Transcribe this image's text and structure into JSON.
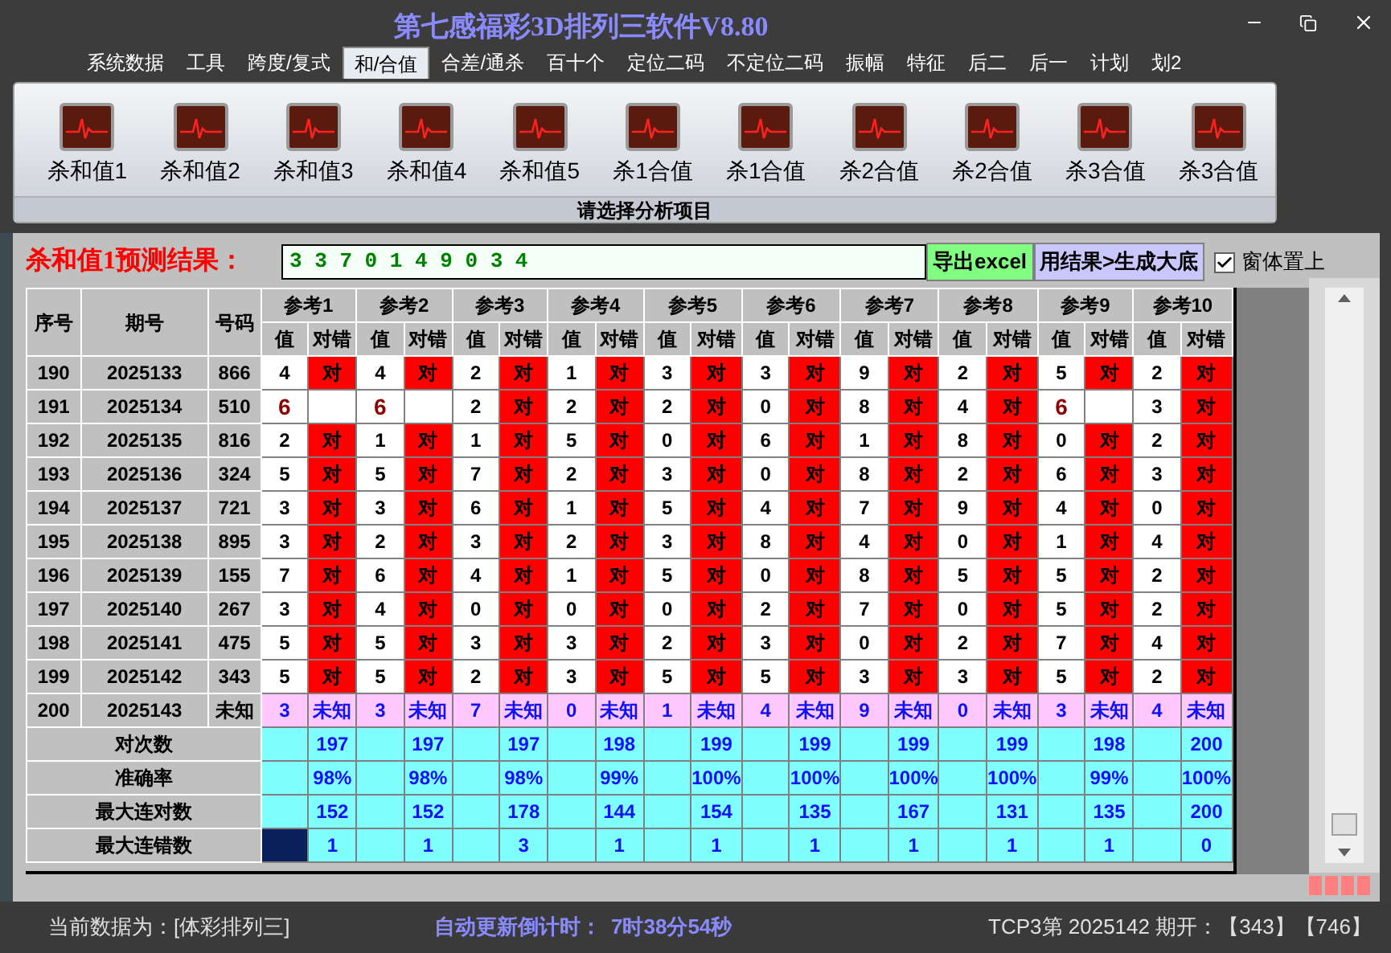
{
  "window": {
    "title": "第七感福彩3D排列三软件V8.80"
  },
  "menu_tabs": [
    {
      "label": "系统数据",
      "selected": false
    },
    {
      "label": "工具",
      "selected": false
    },
    {
      "label": "跨度/复式",
      "selected": false
    },
    {
      "label": "和/合值",
      "selected": true
    },
    {
      "label": "合差/通杀",
      "selected": false
    },
    {
      "label": "百十个",
      "selected": false
    },
    {
      "label": "定位二码",
      "selected": false
    },
    {
      "label": "不定位二码",
      "selected": false
    },
    {
      "label": "振幅",
      "selected": false
    },
    {
      "label": "特征",
      "selected": false
    },
    {
      "label": "后二",
      "selected": false
    },
    {
      "label": "后一",
      "selected": false
    },
    {
      "label": "计划",
      "selected": false
    },
    {
      "label": "划2",
      "selected": false
    }
  ],
  "ribbon": {
    "buttons": [
      "杀和值1",
      "杀和值2",
      "杀和值3",
      "杀和值4",
      "杀和值5",
      "杀1合值",
      "杀1合值",
      "杀2合值",
      "杀2合值",
      "杀3合值",
      "杀3合值"
    ],
    "caption": "请选择分析项目"
  },
  "prediction": {
    "label": "杀和值1预测结果：",
    "value": "3 3 7 0 1 4 9 0 3 4"
  },
  "action_buttons": [
    {
      "label": "导出excel",
      "color": "#80ff80"
    },
    {
      "label": "用结果>生成大底",
      "color": "#c8c8ff"
    }
  ],
  "stay_on_top": {
    "label": "窗体置上",
    "checked": true
  },
  "table": {
    "columns": [
      "序号",
      "期号",
      "号码"
    ],
    "ref_groups": [
      {
        "label": "参考1",
        "sub": [
          "值",
          "对错"
        ]
      },
      {
        "label": "参考2",
        "sub": [
          "值",
          "对错"
        ]
      },
      {
        "label": "参考3",
        "sub": [
          "值",
          "对错"
        ]
      },
      {
        "label": "参考4",
        "sub": [
          "值",
          "对错"
        ]
      },
      {
        "label": "参考5",
        "sub": [
          "值",
          "对错"
        ]
      },
      {
        "label": "参考6",
        "sub": [
          "值",
          "对错"
        ]
      },
      {
        "label": "参考7",
        "sub": [
          "值",
          "对错"
        ]
      },
      {
        "label": "参考8",
        "sub": [
          "值",
          "对错"
        ]
      },
      {
        "label": "参考9",
        "sub": [
          "值",
          "对错"
        ]
      },
      {
        "label": "参考10",
        "sub": [
          "值",
          "对错"
        ]
      }
    ],
    "rows": [
      {
        "kind": "past",
        "seq": "190",
        "period": "2025133",
        "number": "866",
        "refs": [
          {
            "v": "4",
            "r": "对"
          },
          {
            "v": "4",
            "r": "对"
          },
          {
            "v": "2",
            "r": "对"
          },
          {
            "v": "1",
            "r": "对"
          },
          {
            "v": "3",
            "r": "对"
          },
          {
            "v": "3",
            "r": "对"
          },
          {
            "v": "9",
            "r": "对"
          },
          {
            "v": "2",
            "r": "对"
          },
          {
            "v": "5",
            "r": "对"
          },
          {
            "v": "2",
            "r": "对"
          }
        ]
      },
      {
        "kind": "past",
        "seq": "191",
        "period": "2025134",
        "number": "510",
        "refs": [
          {
            "v": "6"
          },
          {
            "v": "6"
          },
          {
            "v": "2",
            "r": "对"
          },
          {
            "v": "2",
            "r": "对"
          },
          {
            "v": "2",
            "r": "对"
          },
          {
            "v": "0",
            "r": "对"
          },
          {
            "v": "8",
            "r": "对"
          },
          {
            "v": "4",
            "r": "对"
          },
          {
            "v": "6"
          },
          {
            "v": "3",
            "r": "对"
          }
        ]
      },
      {
        "kind": "past",
        "seq": "192",
        "period": "2025135",
        "number": "816",
        "refs": [
          {
            "v": "2",
            "r": "对"
          },
          {
            "v": "1",
            "r": "对"
          },
          {
            "v": "1",
            "r": "对"
          },
          {
            "v": "5",
            "r": "对"
          },
          {
            "v": "0",
            "r": "对"
          },
          {
            "v": "6",
            "r": "对"
          },
          {
            "v": "1",
            "r": "对"
          },
          {
            "v": "8",
            "r": "对"
          },
          {
            "v": "0",
            "r": "对"
          },
          {
            "v": "2",
            "r": "对"
          }
        ]
      },
      {
        "kind": "past",
        "seq": "193",
        "period": "2025136",
        "number": "324",
        "refs": [
          {
            "v": "5",
            "r": "对"
          },
          {
            "v": "5",
            "r": "对"
          },
          {
            "v": "7",
            "r": "对"
          },
          {
            "v": "2",
            "r": "对"
          },
          {
            "v": "3",
            "r": "对"
          },
          {
            "v": "0",
            "r": "对"
          },
          {
            "v": "8",
            "r": "对"
          },
          {
            "v": "2",
            "r": "对"
          },
          {
            "v": "6",
            "r": "对"
          },
          {
            "v": "3",
            "r": "对"
          }
        ]
      },
      {
        "kind": "past",
        "seq": "194",
        "period": "2025137",
        "number": "721",
        "refs": [
          {
            "v": "3",
            "r": "对"
          },
          {
            "v": "3",
            "r": "对"
          },
          {
            "v": "6",
            "r": "对"
          },
          {
            "v": "1",
            "r": "对"
          },
          {
            "v": "5",
            "r": "对"
          },
          {
            "v": "4",
            "r": "对"
          },
          {
            "v": "7",
            "r": "对"
          },
          {
            "v": "9",
            "r": "对"
          },
          {
            "v": "4",
            "r": "对"
          },
          {
            "v": "0",
            "r": "对"
          }
        ]
      },
      {
        "kind": "past",
        "seq": "195",
        "period": "2025138",
        "number": "895",
        "refs": [
          {
            "v": "3",
            "r": "对"
          },
          {
            "v": "2",
            "r": "对"
          },
          {
            "v": "3",
            "r": "对"
          },
          {
            "v": "2",
            "r": "对"
          },
          {
            "v": "3",
            "r": "对"
          },
          {
            "v": "8",
            "r": "对"
          },
          {
            "v": "4",
            "r": "对"
          },
          {
            "v": "0",
            "r": "对"
          },
          {
            "v": "1",
            "r": "对"
          },
          {
            "v": "4",
            "r": "对"
          }
        ]
      },
      {
        "kind": "past",
        "seq": "196",
        "period": "2025139",
        "number": "155",
        "refs": [
          {
            "v": "7",
            "r": "对"
          },
          {
            "v": "6",
            "r": "对"
          },
          {
            "v": "4",
            "r": "对"
          },
          {
            "v": "1",
            "r": "对"
          },
          {
            "v": "5",
            "r": "对"
          },
          {
            "v": "0",
            "r": "对"
          },
          {
            "v": "8",
            "r": "对"
          },
          {
            "v": "5",
            "r": "对"
          },
          {
            "v": "5",
            "r": "对"
          },
          {
            "v": "2",
            "r": "对"
          }
        ]
      },
      {
        "kind": "past",
        "seq": "197",
        "period": "2025140",
        "number": "267",
        "refs": [
          {
            "v": "3",
            "r": "对"
          },
          {
            "v": "4",
            "r": "对"
          },
          {
            "v": "0",
            "r": "对"
          },
          {
            "v": "0",
            "r": "对"
          },
          {
            "v": "0",
            "r": "对"
          },
          {
            "v": "2",
            "r": "对"
          },
          {
            "v": "7",
            "r": "对"
          },
          {
            "v": "0",
            "r": "对"
          },
          {
            "v": "5",
            "r": "对"
          },
          {
            "v": "2",
            "r": "对"
          }
        ]
      },
      {
        "kind": "past",
        "seq": "198",
        "period": "2025141",
        "number": "475",
        "refs": [
          {
            "v": "5",
            "r": "对"
          },
          {
            "v": "5",
            "r": "对"
          },
          {
            "v": "3",
            "r": "对"
          },
          {
            "v": "3",
            "r": "对"
          },
          {
            "v": "2",
            "r": "对"
          },
          {
            "v": "3",
            "r": "对"
          },
          {
            "v": "0",
            "r": "对"
          },
          {
            "v": "2",
            "r": "对"
          },
          {
            "v": "7",
            "r": "对"
          },
          {
            "v": "4",
            "r": "对"
          }
        ]
      },
      {
        "kind": "past",
        "seq": "199",
        "period": "2025142",
        "number": "343",
        "refs": [
          {
            "v": "5",
            "r": "对"
          },
          {
            "v": "5",
            "r": "对"
          },
          {
            "v": "2",
            "r": "对"
          },
          {
            "v": "3",
            "r": "对"
          },
          {
            "v": "5",
            "r": "对"
          },
          {
            "v": "5",
            "r": "对"
          },
          {
            "v": "3",
            "r": "对"
          },
          {
            "v": "3",
            "r": "对"
          },
          {
            "v": "5",
            "r": "对"
          },
          {
            "v": "2",
            "r": "对"
          }
        ]
      },
      {
        "kind": "pending",
        "seq": "200",
        "period": "2025143",
        "number": "未知",
        "refs": [
          {
            "v": "3",
            "r": "未知"
          },
          {
            "v": "3",
            "r": "未知"
          },
          {
            "v": "7",
            "r": "未知"
          },
          {
            "v": "0",
            "r": "未知"
          },
          {
            "v": "1",
            "r": "未知"
          },
          {
            "v": "4",
            "r": "未知"
          },
          {
            "v": "9",
            "r": "未知"
          },
          {
            "v": "0",
            "r": "未知"
          },
          {
            "v": "3",
            "r": "未知"
          },
          {
            "v": "4",
            "r": "未知"
          }
        ]
      }
    ],
    "summary": [
      {
        "label": "对次数",
        "selected": false,
        "values": [
          "197",
          "197",
          "197",
          "198",
          "199",
          "199",
          "199",
          "199",
          "198",
          "200"
        ]
      },
      {
        "label": "准确率",
        "selected": false,
        "values": [
          "98%",
          "98%",
          "98%",
          "99%",
          "100%",
          "100%",
          "100%",
          "100%",
          "99%",
          "100%"
        ]
      },
      {
        "label": "最大连对数",
        "selected": false,
        "values": [
          "152",
          "152",
          "178",
          "144",
          "154",
          "135",
          "167",
          "131",
          "135",
          "200"
        ]
      },
      {
        "label": "最大连错数",
        "selected": true,
        "values": [
          "1",
          "1",
          "3",
          "1",
          "1",
          "1",
          "1",
          "1",
          "1",
          "0"
        ]
      }
    ]
  },
  "status_bar": {
    "data_source": "当前数据为：[体彩排列三]",
    "countdown_label": "自动更新倒计时：",
    "countdown_value": "7时38分54秒",
    "last_draw": "TCP3第 2025142 期开：【343】【746】"
  }
}
